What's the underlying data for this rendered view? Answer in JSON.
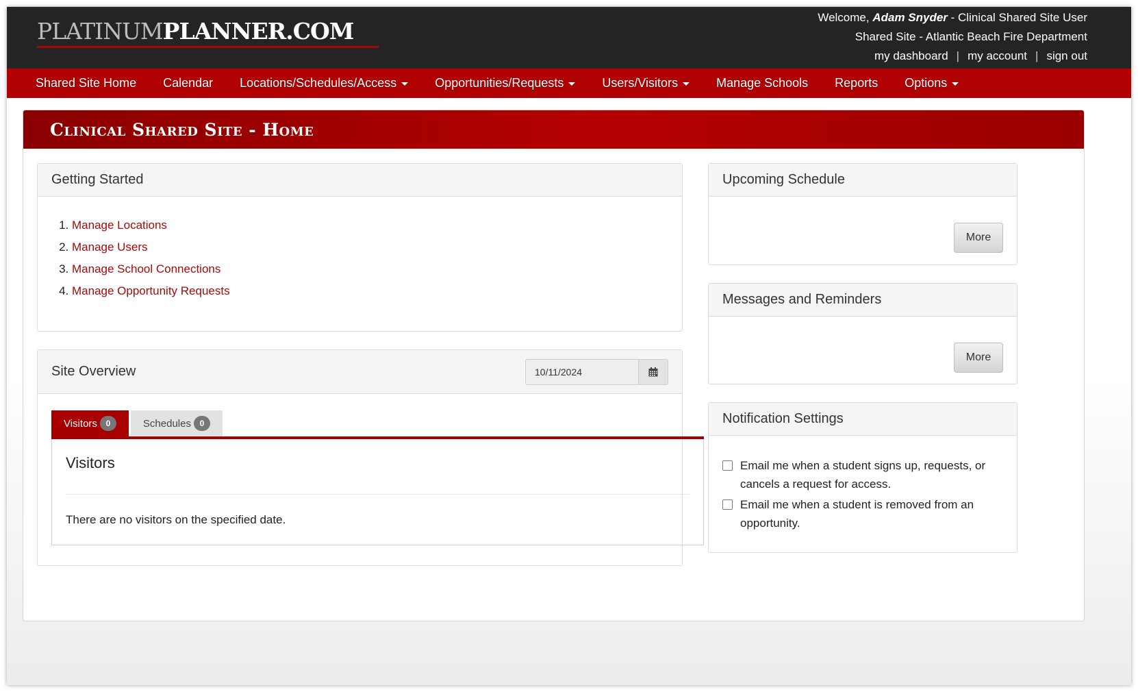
{
  "header": {
    "logo_part1": "PLATINUM",
    "logo_part2": "PLANNER.COM",
    "welcome_prefix": "Welcome, ",
    "user_name": "Adam Snyder",
    "user_role": " - Clinical Shared Site User",
    "site_name": "Shared Site - Atlantic Beach Fire Department",
    "links": {
      "dashboard": "my dashboard",
      "account": "my account",
      "signout": "sign out",
      "separator": "|"
    }
  },
  "nav": {
    "items": [
      {
        "label": "Shared Site Home",
        "dropdown": false
      },
      {
        "label": "Calendar",
        "dropdown": false
      },
      {
        "label": "Locations/Schedules/Access",
        "dropdown": true
      },
      {
        "label": "Opportunities/Requests",
        "dropdown": true
      },
      {
        "label": "Users/Visitors",
        "dropdown": true
      },
      {
        "label": "Manage Schools",
        "dropdown": false
      },
      {
        "label": "Reports",
        "dropdown": false
      },
      {
        "label": "Options",
        "dropdown": true
      }
    ]
  },
  "page": {
    "title": "Clinical Shared Site - Home"
  },
  "getting_started": {
    "title": "Getting Started",
    "items": [
      "Manage Locations",
      "Manage Users",
      "Manage School Connections",
      "Manage Opportunity Requests"
    ]
  },
  "site_overview": {
    "title": "Site Overview",
    "date_value": "10/11/2024",
    "tabs": [
      {
        "label": "Visitors",
        "count": "0",
        "active": true
      },
      {
        "label": "Schedules",
        "count": "0",
        "active": false
      }
    ],
    "content_title": "Visitors",
    "content_text": "There are no visitors on the specified date."
  },
  "upcoming_schedule": {
    "title": "Upcoming Schedule",
    "more_label": "More"
  },
  "messages": {
    "title": "Messages and Reminders",
    "more_label": "More"
  },
  "notifications": {
    "title": "Notification Settings",
    "options": [
      {
        "label": "Email me when a student signs up, requests, or cancels a request for access.",
        "checked": false
      },
      {
        "label": "Email me when a student is removed from an opportunity.",
        "checked": false
      }
    ]
  },
  "colors": {
    "brand_red": "#b10000",
    "header_dark": "#252323",
    "link_red": "#a10b0b"
  }
}
